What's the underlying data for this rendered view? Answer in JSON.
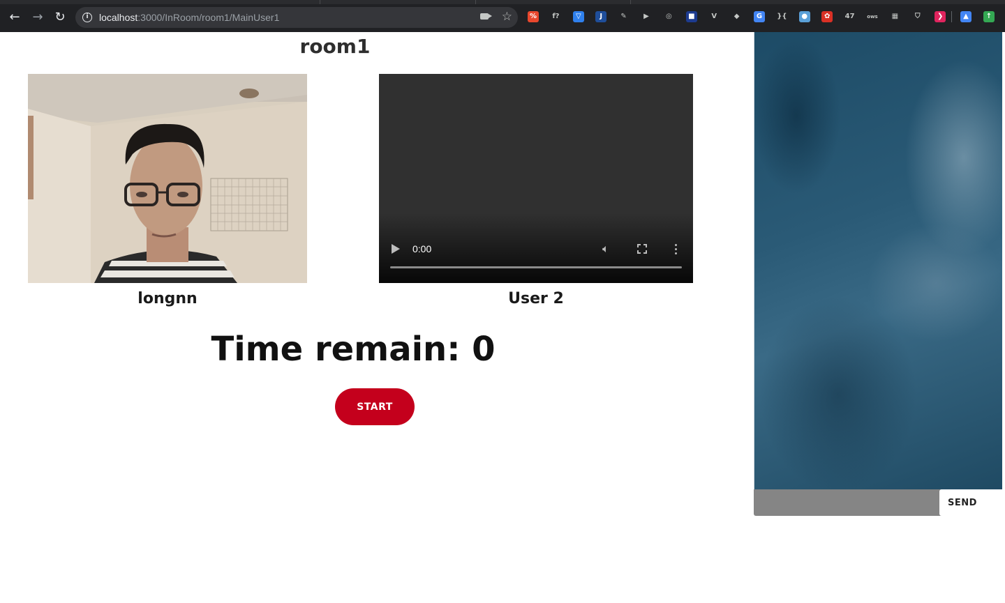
{
  "browser": {
    "url_host": "localhost",
    "url_path": ":3000/InRoom/room1/MainUser1",
    "extensions": [
      {
        "name": "ext-grammar-icon",
        "label": "%",
        "color": "#e8472d"
      },
      {
        "name": "ext-font-icon",
        "label": "f?",
        "color": "#202124"
      },
      {
        "name": "ext-pocket-icon",
        "label": "▽",
        "color": "#2f80ed"
      },
      {
        "name": "ext-j-icon",
        "label": "J",
        "color": "#1f4e9a"
      },
      {
        "name": "ext-pen-icon",
        "label": "✎",
        "color": "#202124"
      },
      {
        "name": "ext-play-icon",
        "label": "▶",
        "color": "#202124"
      },
      {
        "name": "ext-target-icon",
        "label": "◎",
        "color": "#202124"
      },
      {
        "name": "ext-square-icon",
        "label": "■",
        "color": "#1d3b8f"
      },
      {
        "name": "ext-vue-icon",
        "label": "V",
        "color": "#202124"
      },
      {
        "name": "ext-cube-icon",
        "label": "◆",
        "color": "#202124"
      },
      {
        "name": "ext-translate-icon",
        "label": "G",
        "color": "#4285f4"
      },
      {
        "name": "ext-bracket-icon",
        "label": "}{",
        "color": "#202124"
      },
      {
        "name": "ext-circle-icon",
        "label": "●",
        "color": "#5aa0d8"
      },
      {
        "name": "ext-red-icon",
        "label": "✿",
        "color": "#d93025"
      },
      {
        "name": "ext-counter-icon",
        "label": "47",
        "color": "#202124"
      },
      {
        "name": "ext-ows-icon",
        "label": "ows",
        "color": "#202124"
      },
      {
        "name": "ext-box-icon",
        "label": "▦",
        "color": "#202124"
      },
      {
        "name": "ext-shield-icon",
        "label": "⛉",
        "color": "#202124"
      },
      {
        "name": "ext-bookmark-icon",
        "label": "❯",
        "color": "#e0245e"
      },
      {
        "name": "ext-drive-icon",
        "label": "▲",
        "color": "#4285f4"
      },
      {
        "name": "ext-up-icon",
        "label": "↑",
        "color": "#34a853"
      }
    ]
  },
  "room": {
    "title": "room1"
  },
  "videos": {
    "local_name": "longnn",
    "remote_name": "User 2",
    "remote_time": "0:00"
  },
  "timer": {
    "label": "Time remain: 0"
  },
  "controls": {
    "start_label": "START"
  },
  "chat": {
    "input_value": "",
    "send_label": "SEND"
  },
  "colors": {
    "accent": "#c4001c",
    "chat_bg": "#2a5a76"
  }
}
